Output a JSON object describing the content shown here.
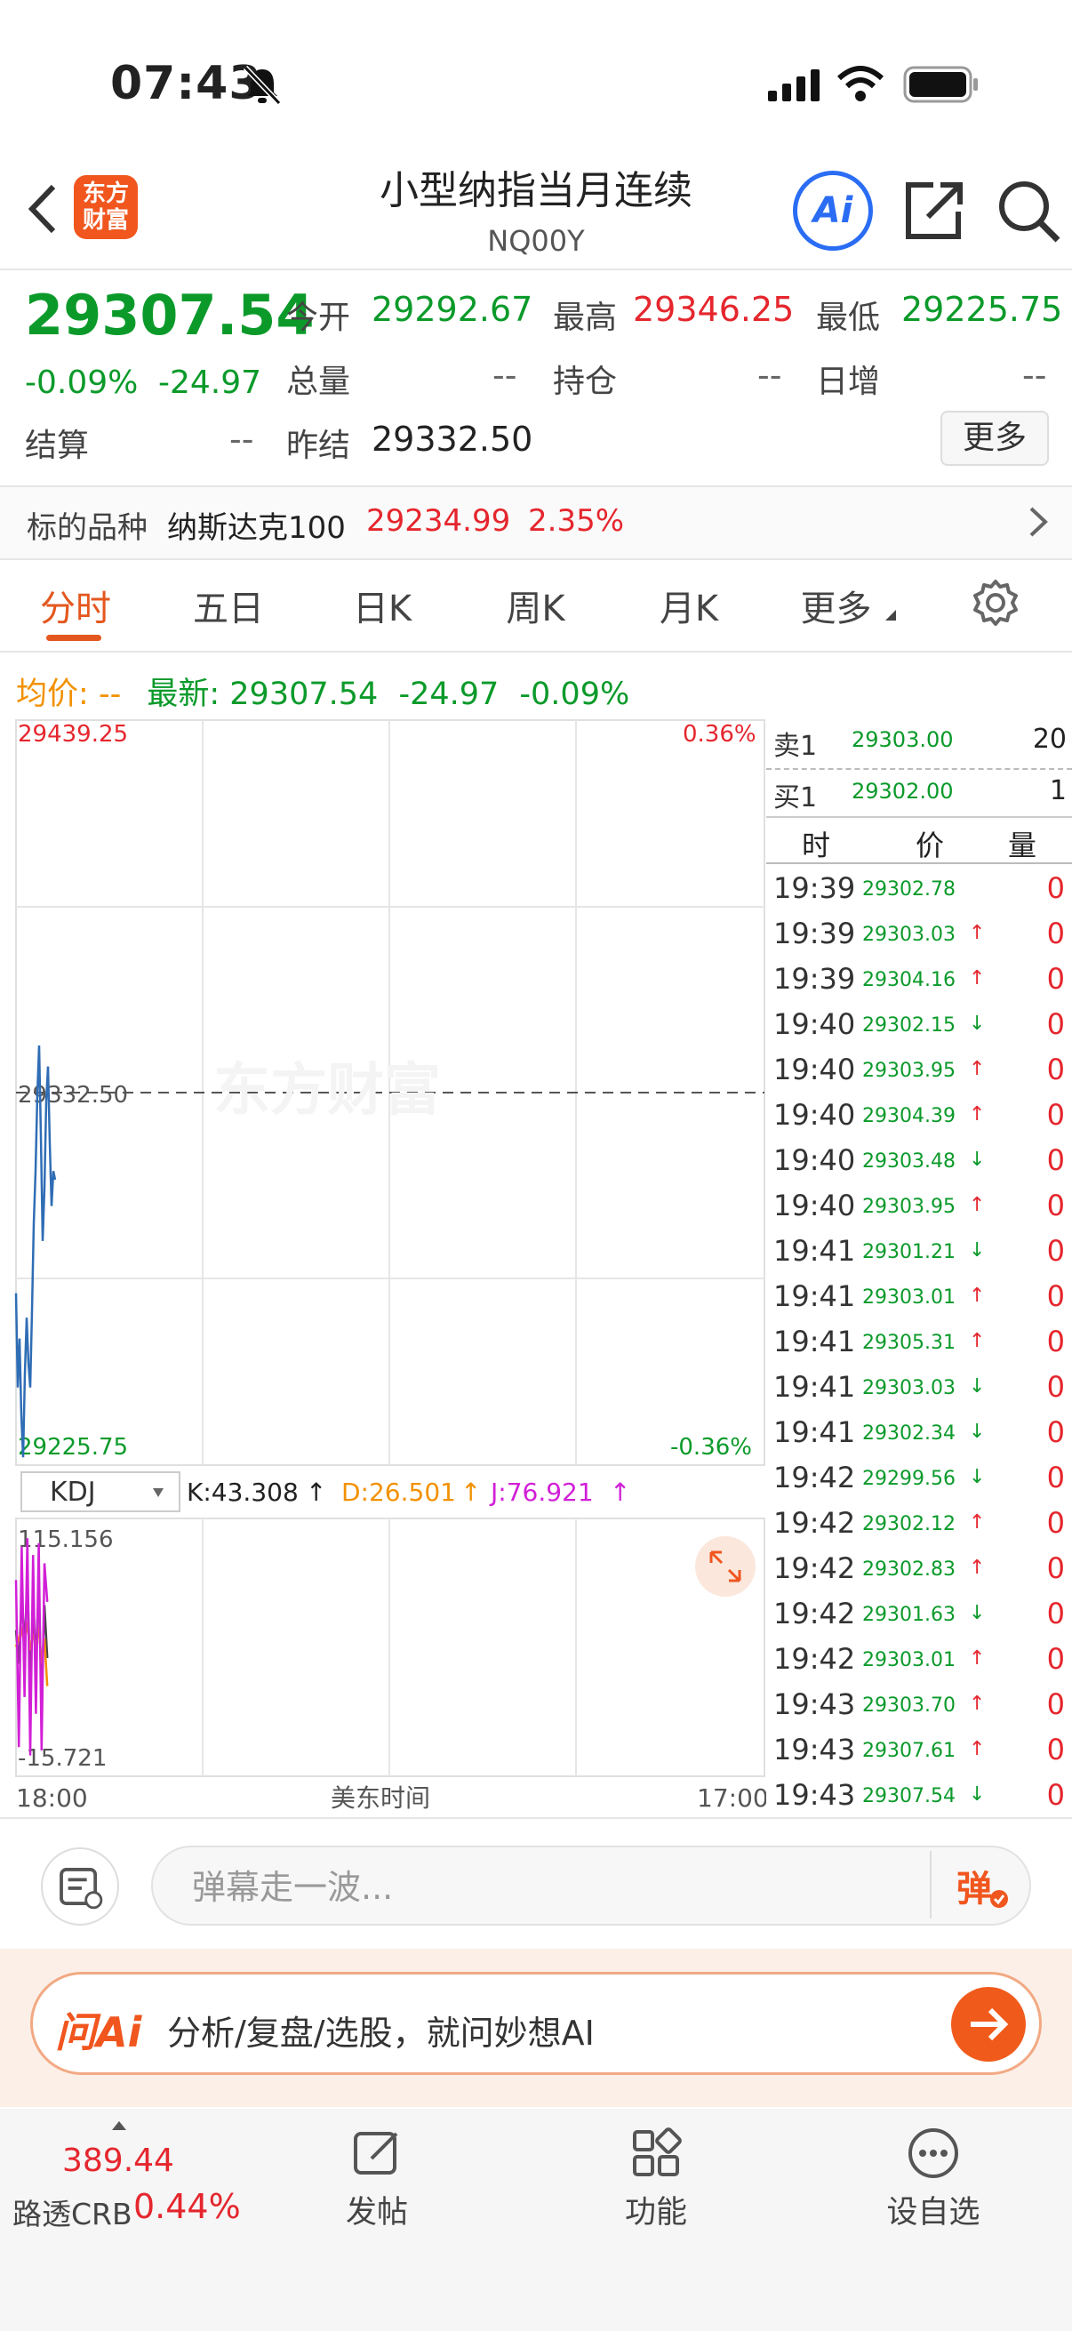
{
  "status_bar": {
    "time": "07:43"
  },
  "header": {
    "logo_text": "东方财富",
    "title": "小型纳指当月连续",
    "subtitle": "NQ00Y",
    "ai_label": "Ai"
  },
  "quote": {
    "last": "29307.54",
    "change_pct": "-0.09%",
    "change": "-24.97",
    "open_label": "今开",
    "open": "29292.67",
    "high_label": "最高",
    "high": "29346.25",
    "low_label": "最低",
    "low": "29225.75",
    "volume_label": "总量",
    "volume": "--",
    "oi_label": "持仓",
    "oi": "--",
    "daily_inc_label": "日增",
    "daily_inc": "--",
    "settle_label": "结算",
    "settle": "--",
    "prev_settle_label": "昨结",
    "prev_settle": "29332.50",
    "more_label": "更多"
  },
  "underlying": {
    "label": "标的品种",
    "name": "纳斯达克100",
    "price": "29234.99",
    "pct": "2.35%"
  },
  "tabs": [
    "分时",
    "五日",
    "日K",
    "周K",
    "月K",
    "更多"
  ],
  "info_line": {
    "avg_label": "均价:",
    "avg_value": "--",
    "latest_label": "最新:",
    "latest_value": "29307.54",
    "change": "-24.97",
    "pct": "-0.09%"
  },
  "chart": {
    "price_max": "29439.25",
    "price_min": "29225.75",
    "pct_max": "0.36%",
    "pct_min": "-0.36%",
    "ref_price": "29332.50",
    "watermark": "东方财富",
    "indicator_name": "KDJ",
    "k_text": "K:43.308",
    "d_text": "D:26.501",
    "j_text": "J:76.921",
    "ind_max": "115.156",
    "ind_min": "-15.721",
    "x_start": "18:00",
    "x_mid": "美东时间",
    "x_end": "17:00"
  },
  "chart_data": {
    "type": "line",
    "title": "",
    "xlabel": "美东时间",
    "ylabel": "",
    "ylim": [
      29225.75,
      29439.25
    ],
    "x_range": [
      "18:00",
      "17:00"
    ],
    "reference_line": 29332.5,
    "series": [
      {
        "values": [
          29275,
          29248,
          29262,
          29240,
          29228,
          29252,
          29268,
          29255,
          29248,
          29270,
          29295,
          29310,
          29332,
          29346,
          29320,
          29290,
          29305,
          29330,
          29340,
          29318,
          29300,
          29310,
          29307.54
        ]
      }
    ],
    "indicator": {
      "name": "KDJ",
      "ylim": [
        -15.721,
        115.156
      ],
      "series": [
        {
          "name": "K",
          "values": [
            60,
            40,
            80,
            50,
            90,
            30,
            70,
            45,
            85,
            20,
            75,
            43.308
          ]
        },
        {
          "name": "D",
          "values": [
            50,
            55,
            60,
            52,
            65,
            48,
            58,
            50,
            62,
            40,
            55,
            26.501
          ]
        },
        {
          "name": "J",
          "values": [
            90,
            -10,
            110,
            20,
            115,
            -15,
            105,
            10,
            112,
            -12,
            100,
            76.921
          ]
        }
      ]
    }
  },
  "orderbook": {
    "ask_label": "卖1",
    "ask_price": "29303.00",
    "ask_vol": "20",
    "bid_label": "买1",
    "bid_price": "29302.00",
    "bid_vol": "1",
    "col_time": "时",
    "col_price": "价",
    "col_vol": "量"
  },
  "ticks": [
    {
      "time": "19:39",
      "price": "29302.78",
      "dir": "",
      "vol": "0"
    },
    {
      "time": "19:39",
      "price": "29303.03",
      "dir": "↑",
      "vol": "0"
    },
    {
      "time": "19:39",
      "price": "29304.16",
      "dir": "↑",
      "vol": "0"
    },
    {
      "time": "19:40",
      "price": "29302.15",
      "dir": "↓",
      "vol": "0"
    },
    {
      "time": "19:40",
      "price": "29303.95",
      "dir": "↑",
      "vol": "0"
    },
    {
      "time": "19:40",
      "price": "29304.39",
      "dir": "↑",
      "vol": "0"
    },
    {
      "time": "19:40",
      "price": "29303.48",
      "dir": "↓",
      "vol": "0"
    },
    {
      "time": "19:40",
      "price": "29303.95",
      "dir": "↑",
      "vol": "0"
    },
    {
      "time": "19:41",
      "price": "29301.21",
      "dir": "↓",
      "vol": "0"
    },
    {
      "time": "19:41",
      "price": "29303.01",
      "dir": "↑",
      "vol": "0"
    },
    {
      "time": "19:41",
      "price": "29305.31",
      "dir": "↑",
      "vol": "0"
    },
    {
      "time": "19:41",
      "price": "29303.03",
      "dir": "↓",
      "vol": "0"
    },
    {
      "time": "19:41",
      "price": "29302.34",
      "dir": "↓",
      "vol": "0"
    },
    {
      "time": "19:42",
      "price": "29299.56",
      "dir": "↓",
      "vol": "0"
    },
    {
      "time": "19:42",
      "price": "29302.12",
      "dir": "↑",
      "vol": "0"
    },
    {
      "time": "19:42",
      "price": "29302.83",
      "dir": "↑",
      "vol": "0"
    },
    {
      "time": "19:42",
      "price": "29301.63",
      "dir": "↓",
      "vol": "0"
    },
    {
      "time": "19:42",
      "price": "29303.01",
      "dir": "↑",
      "vol": "0"
    },
    {
      "time": "19:43",
      "price": "29303.70",
      "dir": "↑",
      "vol": "0"
    },
    {
      "time": "19:43",
      "price": "29307.61",
      "dir": "↑",
      "vol": "0"
    },
    {
      "time": "19:43",
      "price": "29307.54",
      "dir": "↓",
      "vol": "0"
    }
  ],
  "danmu": {
    "placeholder": "弹幕走一波...",
    "button": "弹"
  },
  "ai_bar": {
    "logo": "问Ai",
    "prompt": "分析/复盘/选股，就问妙想AI"
  },
  "bottom_nav": {
    "crb_price": "389.44",
    "crb_label": "路透CRB",
    "crb_pct": "0.44%",
    "post_label": "发帖",
    "func_label": "功能",
    "watch_label": "设自选"
  },
  "colors": {
    "up": "#e5262d",
    "down": "#0b9a2a",
    "accent": "#e4571e",
    "line": "#2f6db5",
    "kdj": "#d21fd6"
  }
}
